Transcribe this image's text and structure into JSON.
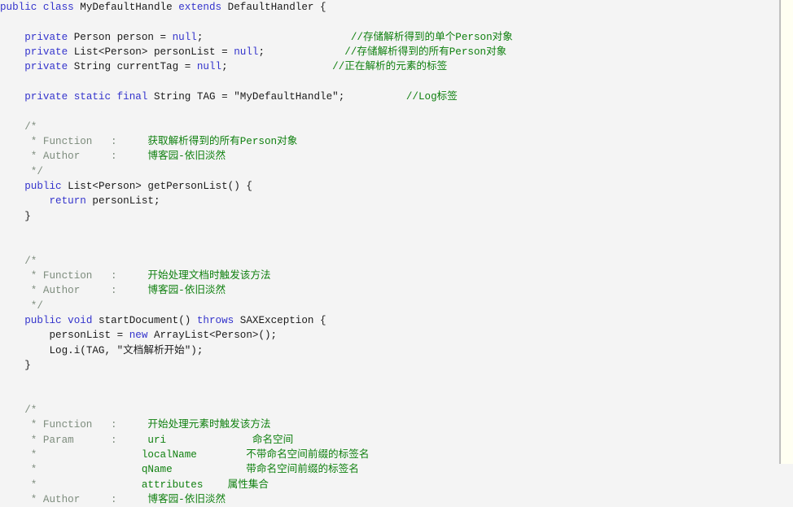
{
  "editor": {
    "language": "Java",
    "class_name": "MyDefaultHandle",
    "colors": {
      "background": "#f4f4f4",
      "gutter_strip": "#fffff2",
      "rule": "#c8c8c8",
      "keyword": "#3333cc",
      "comment_ascii": "#7d8c7d",
      "comment_cjk": "#108010",
      "plain": "#1a1a1a"
    }
  },
  "code_lines": [
    {
      "id": "l1",
      "indent": 0,
      "parts": [
        {
          "t": "public",
          "c": "kw"
        },
        {
          "t": " ",
          "c": "pl"
        },
        {
          "t": "class",
          "c": "kw"
        },
        {
          "t": " MyDefaultHandle ",
          "c": "pl"
        },
        {
          "t": "extends",
          "c": "kw"
        },
        {
          "t": " DefaultHandler {",
          "c": "pl"
        }
      ]
    },
    {
      "id": "l2",
      "indent": 0,
      "parts": []
    },
    {
      "id": "l3",
      "indent": 2,
      "parts": [
        {
          "t": "private",
          "c": "kw"
        },
        {
          "t": " Person person = ",
          "c": "pl"
        },
        {
          "t": "null",
          "c": "kw"
        },
        {
          "t": ";",
          "c": "pl"
        },
        {
          "t": "                        ",
          "c": "pl"
        },
        {
          "t": "//",
          "c": "cn"
        },
        {
          "t": "存储解析得到的单个",
          "c": "cn"
        },
        {
          "t": "Person",
          "c": "cn"
        },
        {
          "t": "对象",
          "c": "cn"
        }
      ]
    },
    {
      "id": "l4",
      "indent": 2,
      "parts": [
        {
          "t": "private",
          "c": "kw"
        },
        {
          "t": " List<Person> personList = ",
          "c": "pl"
        },
        {
          "t": "null",
          "c": "kw"
        },
        {
          "t": ";",
          "c": "pl"
        },
        {
          "t": "             ",
          "c": "pl"
        },
        {
          "t": "//",
          "c": "cn"
        },
        {
          "t": "存储解析得到的所有",
          "c": "cn"
        },
        {
          "t": "Person",
          "c": "cn"
        },
        {
          "t": "对象",
          "c": "cn"
        }
      ]
    },
    {
      "id": "l5",
      "indent": 2,
      "parts": [
        {
          "t": "private",
          "c": "kw"
        },
        {
          "t": " String currentTag = ",
          "c": "pl"
        },
        {
          "t": "null",
          "c": "kw"
        },
        {
          "t": ";",
          "c": "pl"
        },
        {
          "t": "                 ",
          "c": "pl"
        },
        {
          "t": "//",
          "c": "cn"
        },
        {
          "t": "正在解析的元素的标签",
          "c": "cn"
        }
      ]
    },
    {
      "id": "l6",
      "indent": 0,
      "parts": []
    },
    {
      "id": "l7",
      "indent": 2,
      "parts": [
        {
          "t": "private",
          "c": "kw"
        },
        {
          "t": " ",
          "c": "pl"
        },
        {
          "t": "static",
          "c": "kw"
        },
        {
          "t": " ",
          "c": "pl"
        },
        {
          "t": "final",
          "c": "kw"
        },
        {
          "t": " String TAG = \"MyDefaultHandle\";",
          "c": "pl"
        },
        {
          "t": "          ",
          "c": "pl"
        },
        {
          "t": "//Log",
          "c": "cn"
        },
        {
          "t": "标签",
          "c": "cn"
        }
      ]
    },
    {
      "id": "l8",
      "indent": 0,
      "parts": []
    },
    {
      "id": "l9",
      "indent": 2,
      "parts": [
        {
          "t": "/*",
          "c": "cm"
        }
      ]
    },
    {
      "id": "l10",
      "indent": 2,
      "parts": [
        {
          "t": " * Function   :   ",
          "c": "cm"
        },
        {
          "t": "  获取解析得到的所有",
          "c": "cn"
        },
        {
          "t": "Person",
          "c": "cn"
        },
        {
          "t": "对象",
          "c": "cn"
        }
      ]
    },
    {
      "id": "l11",
      "indent": 2,
      "parts": [
        {
          "t": " * Author     :   ",
          "c": "cm"
        },
        {
          "t": "  博客园-依旧淡然",
          "c": "cn"
        }
      ]
    },
    {
      "id": "l12",
      "indent": 2,
      "parts": [
        {
          "t": " */",
          "c": "cm"
        }
      ]
    },
    {
      "id": "l13",
      "indent": 2,
      "parts": [
        {
          "t": "public",
          "c": "kw"
        },
        {
          "t": " List<Person> getPersonList() {",
          "c": "pl"
        }
      ]
    },
    {
      "id": "l14",
      "indent": 4,
      "parts": [
        {
          "t": "return",
          "c": "kw"
        },
        {
          "t": " personList;",
          "c": "pl"
        }
      ]
    },
    {
      "id": "l15",
      "indent": 2,
      "parts": [
        {
          "t": "}",
          "c": "pl"
        }
      ]
    },
    {
      "id": "l16",
      "indent": 0,
      "parts": []
    },
    {
      "id": "l17",
      "indent": 0,
      "parts": []
    },
    {
      "id": "l18",
      "indent": 2,
      "parts": [
        {
          "t": "/*",
          "c": "cm"
        }
      ]
    },
    {
      "id": "l19",
      "indent": 2,
      "parts": [
        {
          "t": " * Function   :   ",
          "c": "cm"
        },
        {
          "t": "  开始处理文档时触发该方法",
          "c": "cn"
        }
      ]
    },
    {
      "id": "l20",
      "indent": 2,
      "parts": [
        {
          "t": " * Author     :   ",
          "c": "cm"
        },
        {
          "t": "  博客园-依旧淡然",
          "c": "cn"
        }
      ]
    },
    {
      "id": "l21",
      "indent": 2,
      "parts": [
        {
          "t": " */",
          "c": "cm"
        }
      ]
    },
    {
      "id": "l22",
      "indent": 2,
      "parts": [
        {
          "t": "public",
          "c": "kw"
        },
        {
          "t": " ",
          "c": "pl"
        },
        {
          "t": "void",
          "c": "kw"
        },
        {
          "t": " startDocument() ",
          "c": "pl"
        },
        {
          "t": "throws",
          "c": "kw"
        },
        {
          "t": " SAXException {",
          "c": "pl"
        }
      ]
    },
    {
      "id": "l23",
      "indent": 4,
      "parts": [
        {
          "t": "personList = ",
          "c": "pl"
        },
        {
          "t": "new",
          "c": "kw"
        },
        {
          "t": " ArrayList<Person>();",
          "c": "pl"
        }
      ]
    },
    {
      "id": "l24",
      "indent": 4,
      "parts": [
        {
          "t": "Log.i(TAG, \"文档解析开始\");",
          "c": "pl"
        }
      ]
    },
    {
      "id": "l25",
      "indent": 2,
      "parts": [
        {
          "t": "}",
          "c": "pl"
        }
      ]
    },
    {
      "id": "l26",
      "indent": 0,
      "parts": []
    },
    {
      "id": "l27",
      "indent": 0,
      "parts": []
    },
    {
      "id": "l28",
      "indent": 2,
      "parts": [
        {
          "t": "/*",
          "c": "cm"
        }
      ]
    },
    {
      "id": "l29",
      "indent": 2,
      "parts": [
        {
          "t": " * Function   :   ",
          "c": "cm"
        },
        {
          "t": "  开始处理元素时触发该方法",
          "c": "cn"
        }
      ]
    },
    {
      "id": "l30",
      "indent": 2,
      "parts": [
        {
          "t": " * Param      :   ",
          "c": "cm"
        },
        {
          "t": "  uri              命名空间",
          "c": "cn"
        }
      ]
    },
    {
      "id": "l31",
      "indent": 2,
      "parts": [
        {
          "t": " *               ",
          "c": "cm"
        },
        {
          "t": "  localName        不带命名空间前缀的标签名",
          "c": "cn"
        }
      ]
    },
    {
      "id": "l32",
      "indent": 2,
      "parts": [
        {
          "t": " *               ",
          "c": "cm"
        },
        {
          "t": "  qName            带命名空间前缀的标签名",
          "c": "cn"
        }
      ]
    },
    {
      "id": "l33",
      "indent": 2,
      "parts": [
        {
          "t": " *               ",
          "c": "cm"
        },
        {
          "t": "  attributes    属性集合",
          "c": "cn"
        }
      ]
    },
    {
      "id": "l34",
      "indent": 2,
      "parts": [
        {
          "t": " * Author     :   ",
          "c": "cm"
        },
        {
          "t": "  博客园-依旧淡然",
          "c": "cn"
        }
      ]
    }
  ]
}
